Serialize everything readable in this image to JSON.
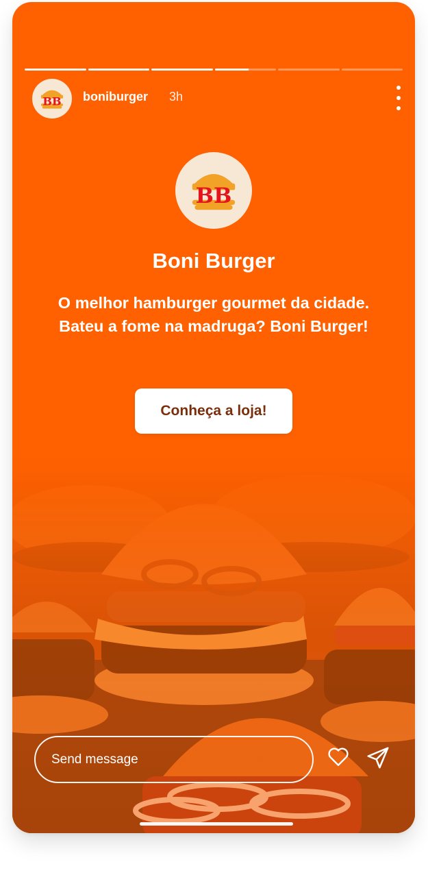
{
  "story": {
    "progress": [
      1,
      1,
      1,
      0.55,
      0,
      0
    ],
    "username": "boniburger",
    "time_ago": "3h",
    "more_icon": "more-vertical-icon"
  },
  "profile": {
    "logo_text": "BB",
    "name": "Boni Burger",
    "description": "O melhor hamburger gourmet da cidade. Bateu a fome na madruga? Boni Burger!",
    "cta_label": "Conheça a loja!"
  },
  "composer": {
    "placeholder": "Send message",
    "like_icon": "heart-icon",
    "send_icon": "send-icon"
  },
  "colors": {
    "primary": "#ff6100",
    "cta_text": "#7a2e0b",
    "logo_red": "#e3141b",
    "avatar_bg": "#f7e8d6"
  }
}
